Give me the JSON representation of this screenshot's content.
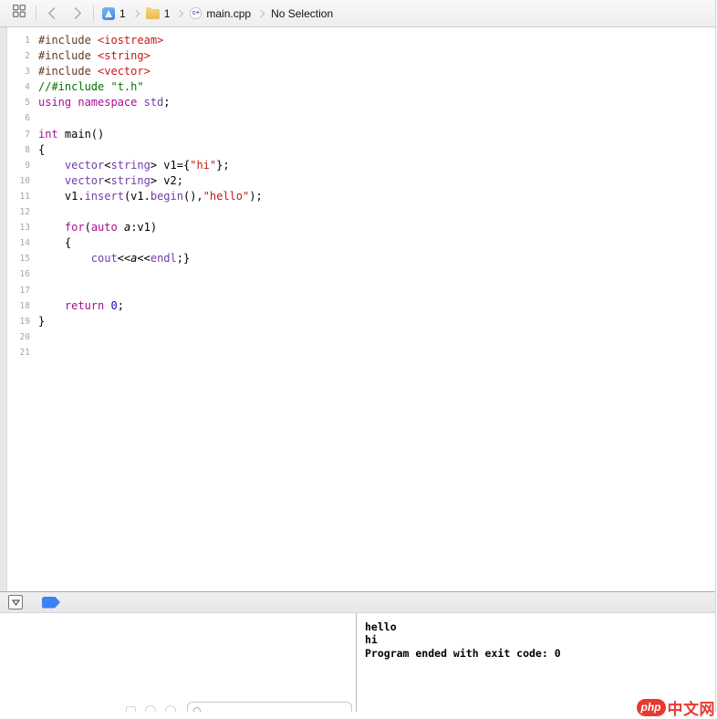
{
  "jumpbar": {
    "related_items_icon": "related-items-grid",
    "nav": {
      "back_icon": "chevron-left",
      "forward_icon": "chevron-right"
    },
    "breadcrumbs": [
      {
        "id": "project",
        "icon": "project",
        "label": "1"
      },
      {
        "id": "group",
        "icon": "folder",
        "label": "1"
      },
      {
        "id": "file",
        "icon": "cpp-file",
        "icon_text": "c+",
        "label": "main.cpp"
      },
      {
        "id": "selection",
        "icon": null,
        "label": "No Selection"
      }
    ]
  },
  "editor": {
    "language": "cpp",
    "lines": [
      {
        "n": "1",
        "segs": [
          [
            "pre",
            "#include "
          ],
          [
            "str",
            "<iostream>"
          ]
        ]
      },
      {
        "n": "2",
        "segs": [
          [
            "pre",
            "#include "
          ],
          [
            "str",
            "<string>"
          ]
        ]
      },
      {
        "n": "3",
        "segs": [
          [
            "pre",
            "#include "
          ],
          [
            "str",
            "<vector>"
          ]
        ]
      },
      {
        "n": "4",
        "segs": [
          [
            "cmt",
            "//#include \"t.h\""
          ]
        ]
      },
      {
        "n": "5",
        "segs": [
          [
            "kw",
            "using namespace "
          ],
          [
            "typ",
            "std"
          ],
          [
            "pln",
            ";"
          ]
        ]
      },
      {
        "n": "6",
        "segs": []
      },
      {
        "n": "7",
        "segs": [
          [
            "kw",
            "int"
          ],
          [
            "pln",
            " main()"
          ]
        ]
      },
      {
        "n": "8",
        "segs": [
          [
            "pln",
            "{"
          ]
        ]
      },
      {
        "n": "9",
        "segs": [
          [
            "pln",
            "    "
          ],
          [
            "typ",
            "vector"
          ],
          [
            "pln",
            "<"
          ],
          [
            "typ",
            "string"
          ],
          [
            "pln",
            "> v1={"
          ],
          [
            "str",
            "\"hi\""
          ],
          [
            "pln",
            "};"
          ]
        ]
      },
      {
        "n": "10",
        "segs": [
          [
            "pln",
            "    "
          ],
          [
            "typ",
            "vector"
          ],
          [
            "pln",
            "<"
          ],
          [
            "typ",
            "string"
          ],
          [
            "pln",
            "> v2;"
          ]
        ]
      },
      {
        "n": "11",
        "segs": [
          [
            "pln",
            "    v1."
          ],
          [
            "typ",
            "insert"
          ],
          [
            "pln",
            "(v1."
          ],
          [
            "typ",
            "begin"
          ],
          [
            "pln",
            "(),"
          ],
          [
            "str",
            "\"hello\""
          ],
          [
            "pln",
            ");"
          ]
        ]
      },
      {
        "n": "12",
        "segs": []
      },
      {
        "n": "13",
        "segs": [
          [
            "pln",
            "    "
          ],
          [
            "kw",
            "for"
          ],
          [
            "pln",
            "("
          ],
          [
            "kw",
            "auto"
          ],
          [
            "pln",
            " "
          ],
          [
            "var",
            "a"
          ],
          [
            "pln",
            ":v1)"
          ]
        ]
      },
      {
        "n": "14",
        "segs": [
          [
            "pln",
            "    {"
          ]
        ]
      },
      {
        "n": "15",
        "segs": [
          [
            "pln",
            "        "
          ],
          [
            "typ",
            "cout"
          ],
          [
            "pln",
            "<<"
          ],
          [
            "var",
            "a"
          ],
          [
            "pln",
            "<<"
          ],
          [
            "typ",
            "endl"
          ],
          [
            "pln",
            ";}"
          ]
        ]
      },
      {
        "n": "16",
        "segs": []
      },
      {
        "n": "17",
        "segs": []
      },
      {
        "n": "18",
        "segs": [
          [
            "pln",
            "    "
          ],
          [
            "kw",
            "return"
          ],
          [
            "pln",
            " "
          ],
          [
            "num",
            "0"
          ],
          [
            "pln",
            ";"
          ]
        ]
      },
      {
        "n": "19",
        "segs": [
          [
            "pln",
            "}"
          ]
        ]
      },
      {
        "n": "20",
        "segs": []
      },
      {
        "n": "21",
        "segs": []
      }
    ]
  },
  "debug_bar": {
    "hide_debug_icon": "triangle-down-in-square",
    "breakpoints_icon": "breakpoint-tag"
  },
  "debug_area": {
    "console": {
      "lines": [
        "hello",
        "hi",
        "Program ended with exit code: 0"
      ]
    },
    "variables_filter": {
      "value": "",
      "icon": "filter-magnifier"
    }
  },
  "watermark": {
    "badge": "php",
    "text": "中文网"
  },
  "colors": {
    "keyword": "#AA0D91",
    "type": "#703DAA",
    "string": "#C41A16",
    "comment": "#007400",
    "preprocessor": "#643820",
    "number": "#1C00CF",
    "breakpoint_blue": "#3B82F7",
    "watermark_red": "#E8392F"
  }
}
